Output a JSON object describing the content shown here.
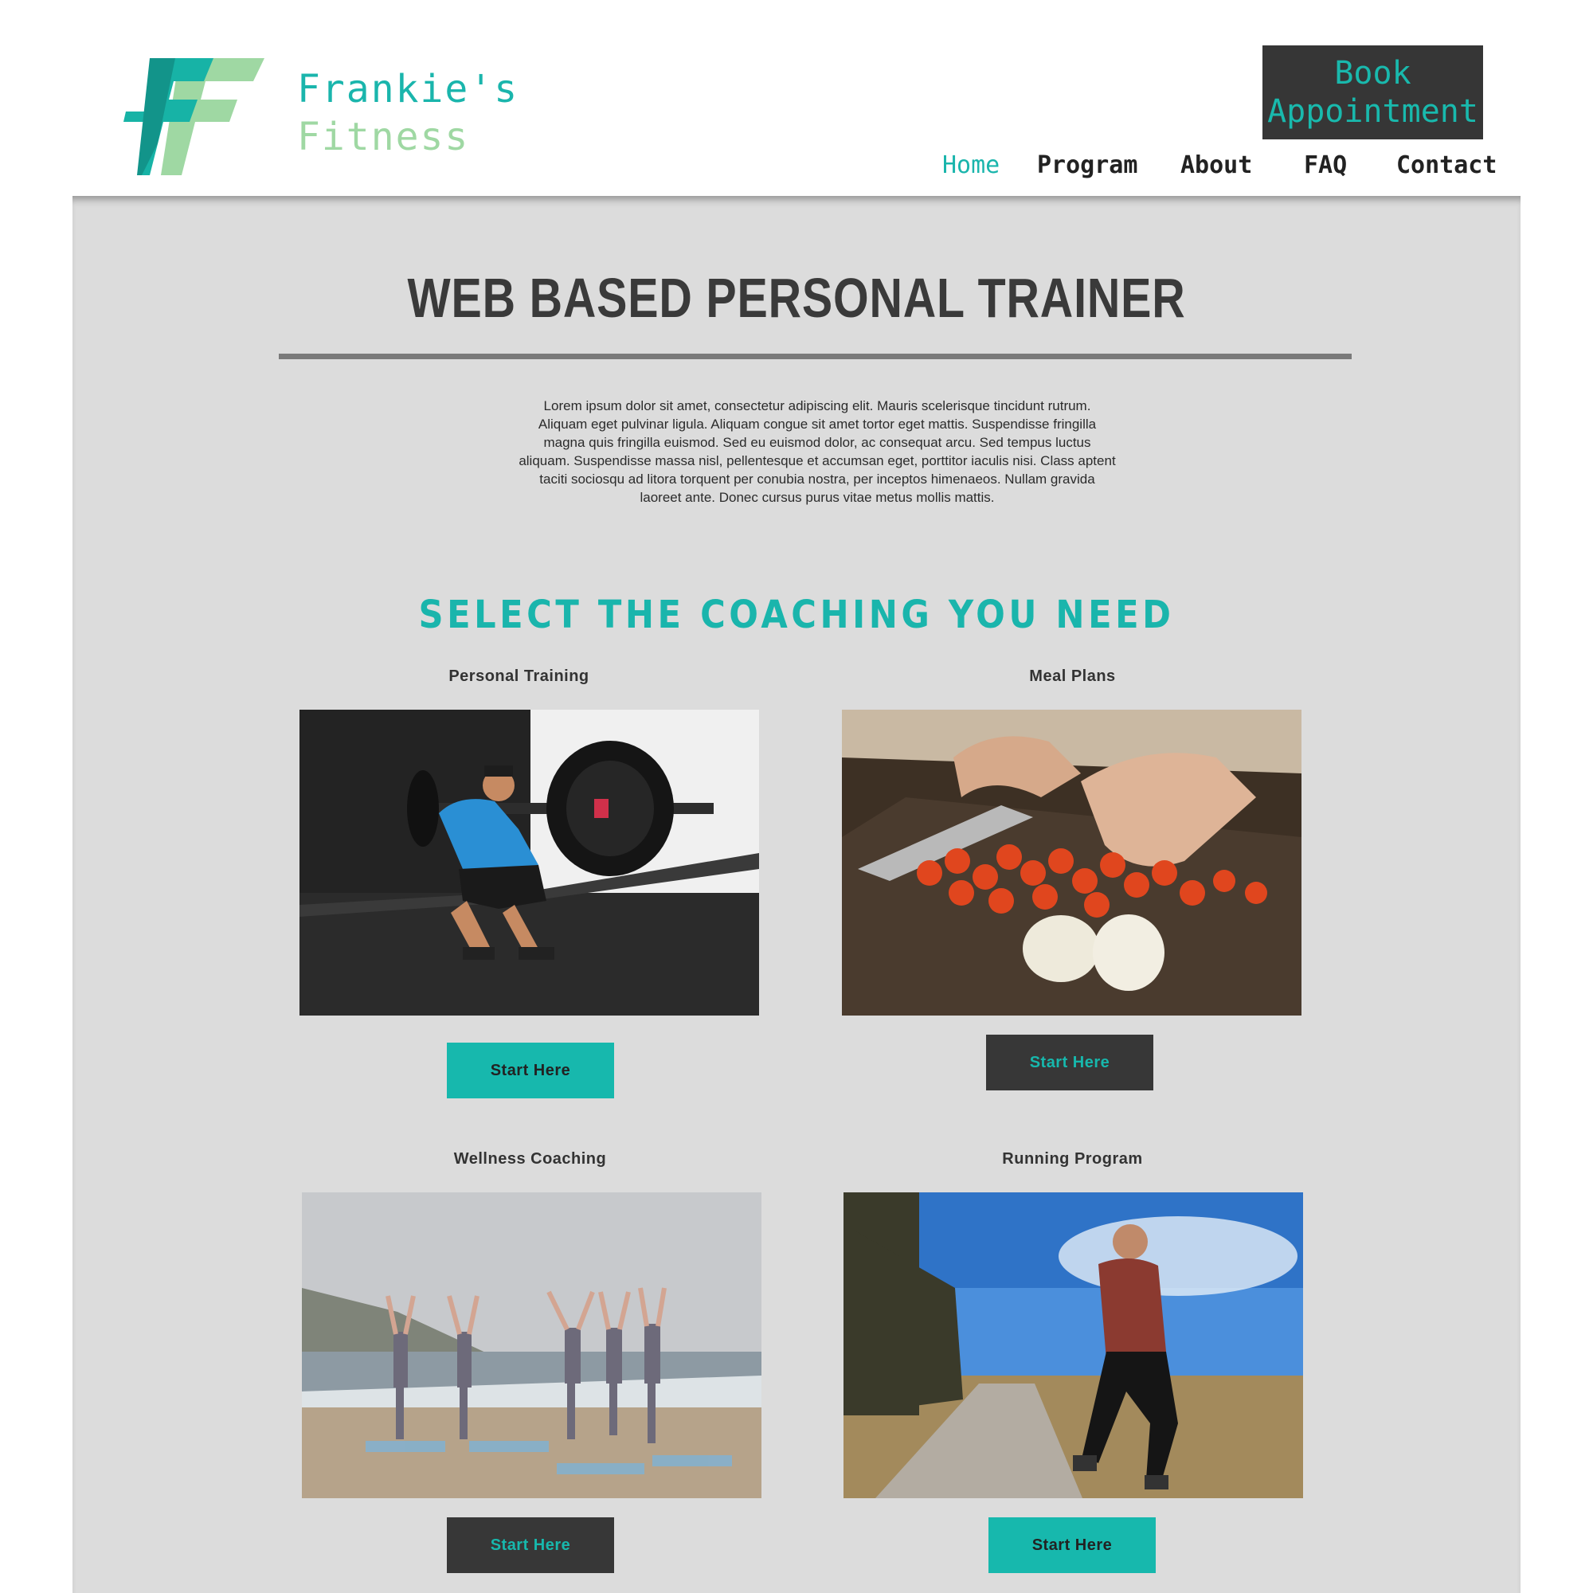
{
  "header": {
    "brand_line1": "Frankie's",
    "brand_line2": "Fitness",
    "book_button": "Book Appointment",
    "nav": [
      {
        "label": "Home",
        "active": true
      },
      {
        "label": "Program"
      },
      {
        "label": "About"
      },
      {
        "label": "FAQ"
      },
      {
        "label": "Contact"
      }
    ]
  },
  "hero": {
    "title": "WEB BASED PERSONAL TRAINER",
    "intro": "Lorem ipsum dolor sit amet, consectetur adipiscing elit. Mauris scelerisque tincidunt rutrum. Aliquam eget pulvinar ligula. Aliquam congue sit amet tortor eget mattis. Suspendisse fringilla magna quis fringilla euismod. Sed eu euismod dolor, ac consequat arcu. Sed tempus luctus aliquam. Suspendisse massa nisl, pellentesque et accumsan eget, porttitor iaculis nisi. Class aptent taciti sociosqu ad litora torquent per conubia nostra, per inceptos himenaeos. Nullam gravida laoreet ante. Donec cursus purus vitae metus mollis mattis."
  },
  "coaching": {
    "title": "SELECT THE COACHING YOU NEED",
    "cards": [
      {
        "label": "Personal Training",
        "button": "Start Here",
        "style": "teal"
      },
      {
        "label": "Meal Plans",
        "button": "Start Here",
        "style": "dark"
      },
      {
        "label": "Wellness Coaching",
        "button": "Start Here",
        "style": "dark"
      },
      {
        "label": "Running Program",
        "button": "Start Here",
        "style": "teal"
      }
    ]
  },
  "colors": {
    "accent": "#1ab5ac",
    "accent_light": "#9fd8a3",
    "dark": "#363636",
    "panel": "#dcdcdc"
  }
}
